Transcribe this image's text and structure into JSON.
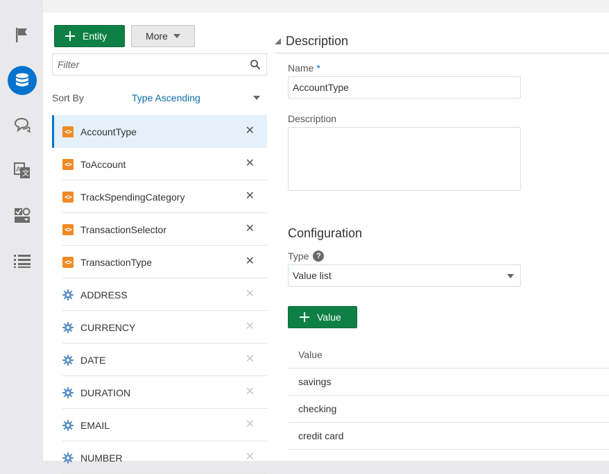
{
  "rail": {
    "items": [
      {
        "icon": "flag-icon",
        "active": false
      },
      {
        "icon": "database-icon",
        "active": true
      },
      {
        "icon": "chat-icon",
        "active": false
      },
      {
        "icon": "translate-icon",
        "active": false
      },
      {
        "icon": "components-icon",
        "active": false
      },
      {
        "icon": "list-icon",
        "active": false
      }
    ]
  },
  "toolbar": {
    "entity_label": "Entity",
    "more_label": "More"
  },
  "filter": {
    "placeholder": "Filter"
  },
  "sort": {
    "label": "Sort By",
    "value": "Type Ascending"
  },
  "entities": [
    {
      "name": "AccountType",
      "type": "custom",
      "selected": true
    },
    {
      "name": "ToAccount",
      "type": "custom"
    },
    {
      "name": "TrackSpendingCategory",
      "type": "custom"
    },
    {
      "name": "TransactionSelector",
      "type": "custom"
    },
    {
      "name": "TransactionType",
      "type": "custom"
    },
    {
      "name": "ADDRESS",
      "type": "system"
    },
    {
      "name": "CURRENCY",
      "type": "system"
    },
    {
      "name": "DATE",
      "type": "system"
    },
    {
      "name": "DURATION",
      "type": "system"
    },
    {
      "name": "EMAIL",
      "type": "system"
    },
    {
      "name": "NUMBER",
      "type": "system"
    }
  ],
  "detail": {
    "description_section": "Description",
    "name_label": "Name",
    "name_required": "*",
    "name_value": "AccountType",
    "description_label": "Description",
    "description_value": "",
    "configuration_section": "Configuration",
    "type_label": "Type",
    "type_help": "?",
    "type_value": "Value list",
    "value_button": "Value",
    "values_header": "Value",
    "values": [
      "savings",
      "checking",
      "credit card"
    ]
  },
  "colors": {
    "accent": "#0572ce",
    "primary_button": "#0e8046",
    "custom_entity": "#f08a24",
    "system_entity": "#5a8fc4"
  }
}
